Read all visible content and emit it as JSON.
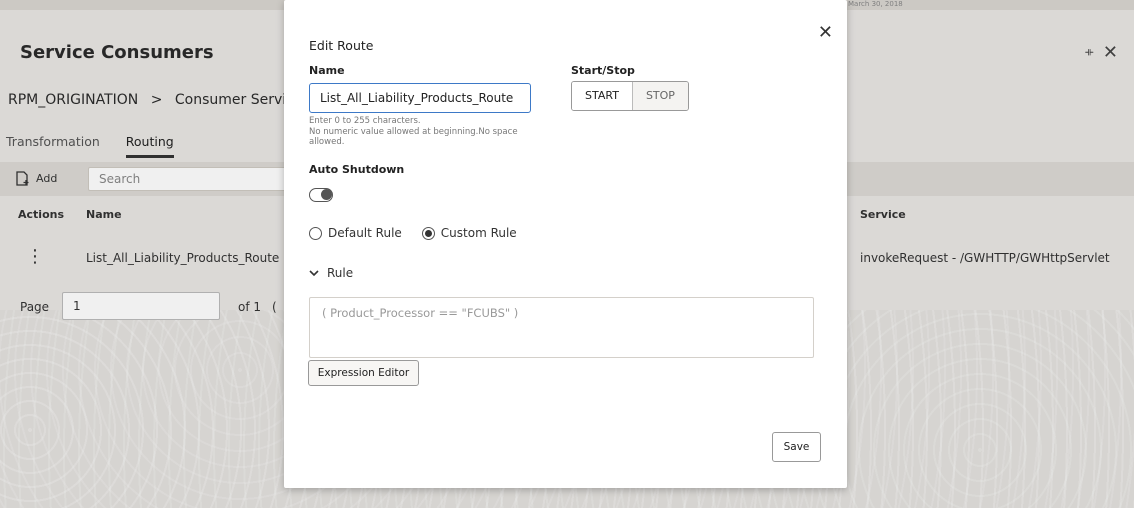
{
  "background": {
    "top_date": "March 30, 2018",
    "app_title": "Service Consumers",
    "breadcrumb": [
      "RPM_ORIGINATION",
      "Consumer Service"
    ],
    "breadcrumb_sep": ">",
    "tabs": [
      "Transformation",
      "Routing"
    ],
    "active_tab": "Routing",
    "toolbar": {
      "add_label": "Add",
      "search_placeholder": "Search"
    },
    "table": {
      "headers": {
        "actions": "Actions",
        "name": "Name",
        "service": "Service"
      },
      "rows": [
        {
          "name": "List_All_Liability_Products_Route",
          "service": "invokeRequest - /GWHTTP/GWHttpServlet"
        }
      ]
    },
    "pager": {
      "label": "Page",
      "value": "1",
      "of": "of 1",
      "paren": "("
    }
  },
  "modal": {
    "title": "Edit Route",
    "name_label": "Name",
    "name_value": "List_All_Liability_Products_Route",
    "hint_lines": [
      "Enter 0 to 255 characters.",
      "No numeric value allowed at beginning.No space allowed."
    ],
    "start_stop_label": "Start/Stop",
    "start_label": "START",
    "stop_label": "STOP",
    "auto_shutdown_label": "Auto Shutdown",
    "auto_shutdown_on": false,
    "rule_options": [
      "Default Rule",
      "Custom Rule"
    ],
    "selected_rule_option": "Custom Rule",
    "rule_section_label": "Rule",
    "rule_expression": "( Product_Processor == \"FCUBS\" )",
    "expression_editor_label": "Expression Editor",
    "save_label": "Save"
  },
  "icons": {
    "close": "close-icon",
    "collapse": "collapse-icon",
    "add": "add-document-icon",
    "kebab": "kebab-menu-icon",
    "chevron": "chevron-down-icon"
  },
  "colors": {
    "input_focus": "#3d79c7"
  }
}
